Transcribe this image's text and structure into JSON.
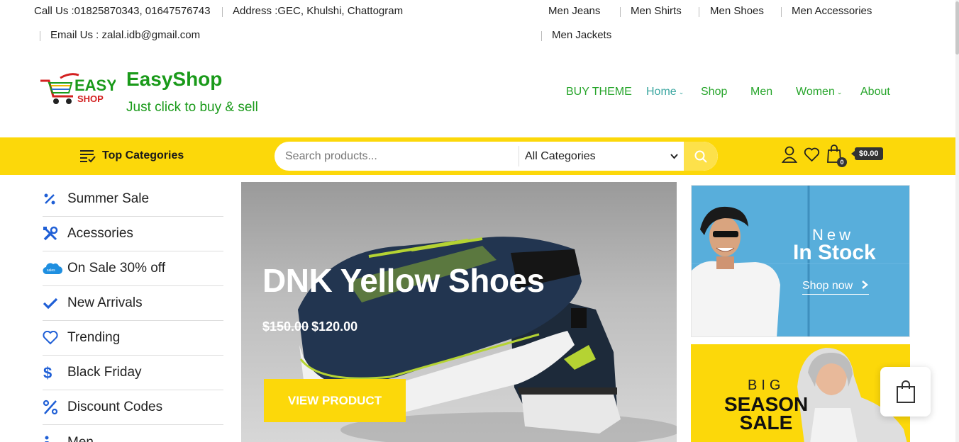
{
  "topbar": {
    "phone": "Call Us :01825870343, 01647576743",
    "address": "Address :GEC, Khulshi, Chattogram",
    "email": "Email Us : zalal.idb@gmail.com",
    "links": [
      "Men Jeans",
      "Men Shirts",
      "Men Shoes",
      "Men Accessories",
      "Men Jackets"
    ]
  },
  "brand": {
    "logo_line1": "EASY",
    "logo_line2": "SHOP",
    "title": "EasyShop",
    "tagline": "Just click to buy & sell"
  },
  "nav": [
    {
      "label": "BUY THEME"
    },
    {
      "label": "Home",
      "dropdown": true
    },
    {
      "label": "Shop"
    },
    {
      "label": "Men"
    },
    {
      "label": "Women",
      "dropdown": true
    },
    {
      "label": "About"
    }
  ],
  "catbar": {
    "top_categories": "Top Categories",
    "search_placeholder": "Search products...",
    "category_select": "All Categories",
    "cart_count": "0",
    "cart_total": "$0.00"
  },
  "sidebar": [
    {
      "label": "Summer Sale",
      "icon": "percent-icon"
    },
    {
      "label": "Acessories",
      "icon": "tools-icon"
    },
    {
      "label": "On Sale 30% off",
      "icon": "salesforce-cloud-icon"
    },
    {
      "label": "New Arrivals",
      "icon": "check-icon"
    },
    {
      "label": "Trending",
      "icon": "heart-icon"
    },
    {
      "label": "Black Friday",
      "icon": "dollar-icon"
    },
    {
      "label": "Discount Codes",
      "icon": "percent-icon"
    },
    {
      "label": "Men",
      "icon": "info-icon"
    }
  ],
  "hero": {
    "title": "DNK Yellow Shoes",
    "old_price": "$150.00",
    "new_price": "$120.00",
    "button": "VIEW PRODUCT"
  },
  "banner1": {
    "line1": "New",
    "line2": "In Stock",
    "link": "Shop now"
  },
  "banner2": {
    "line1": "BIG",
    "line2": "SEASON",
    "line3": "SALE"
  },
  "colors": {
    "brand_green": "#1a9a1a",
    "accent_yellow": "#fcd80a",
    "icon_blue": "#1f5fd6"
  }
}
